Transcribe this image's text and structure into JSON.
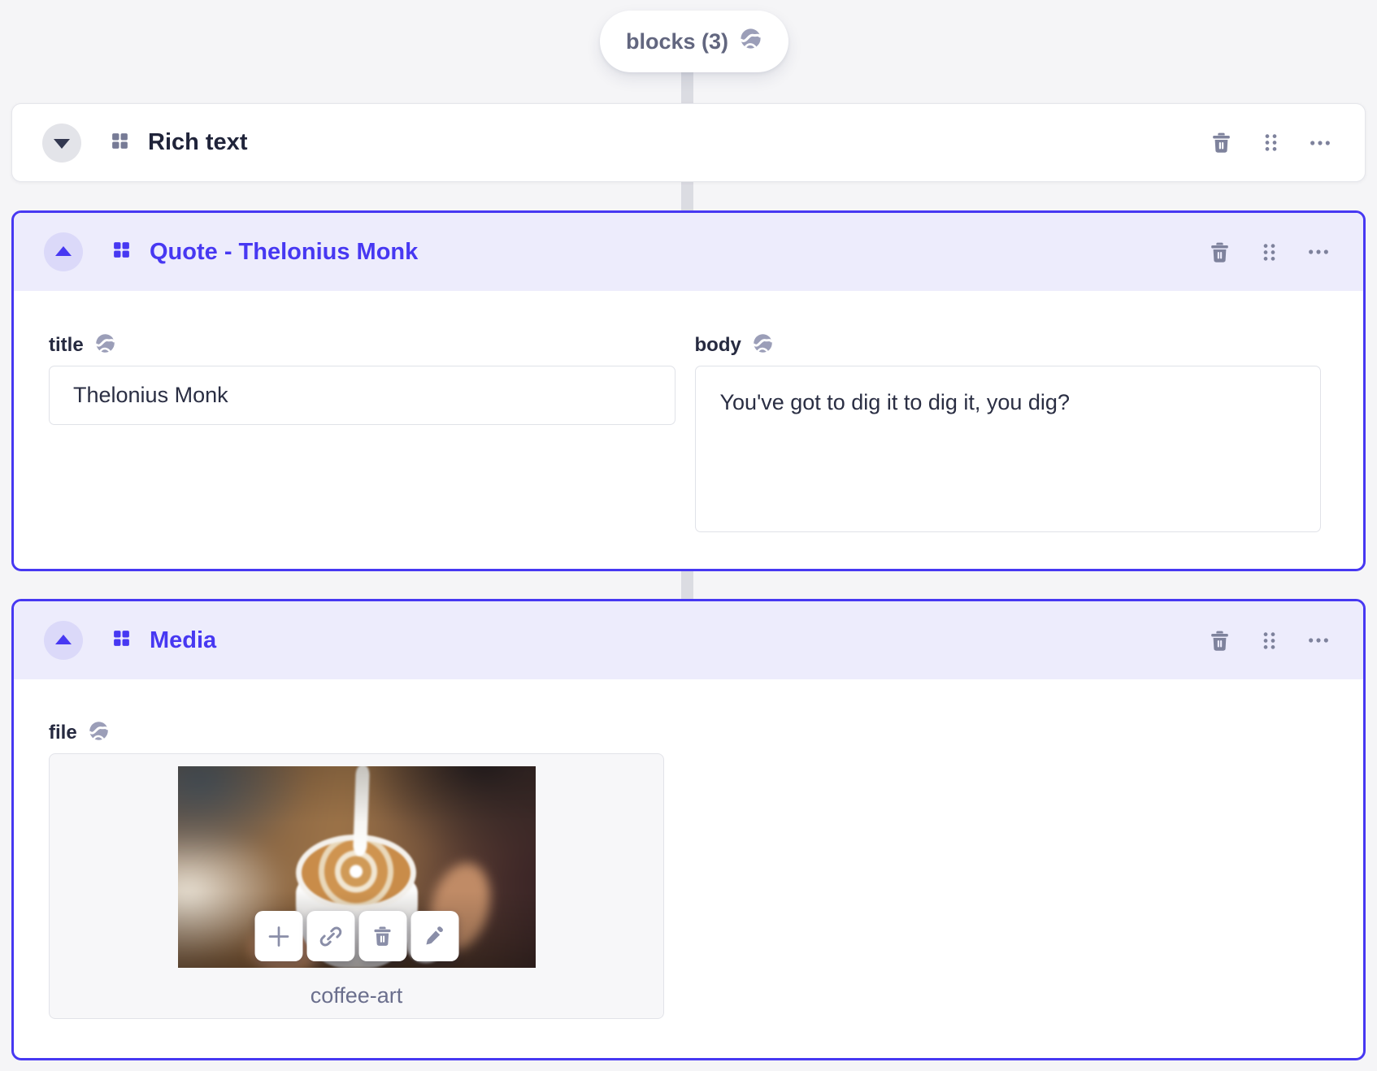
{
  "colors": {
    "accent": "#4738F2",
    "accent_header_bg": "#EDECFC",
    "accent_toggle_bg": "#DBD9F9",
    "muted_icon": "#7E829C",
    "dark_text": "#20243A",
    "muted_text": "#6B6F8D",
    "page_bg": "#F5F5F7",
    "connector": "#DBDCE2"
  },
  "icons": {
    "pill_globe": "globe-icon",
    "block": "blocks-grid-icon",
    "collapse": "chevron-up-icon",
    "expand": "chevron-down-icon",
    "remove": "trash-icon",
    "drag": "drag-handle-icon",
    "menu": "ellipsis-icon",
    "upload": "plus-icon",
    "link": "link-icon",
    "delete_asset": "trash-icon",
    "edit": "pencil-icon"
  },
  "array_field": {
    "pill_label": "blocks (3)"
  },
  "blocks": [
    {
      "title": "Rich text",
      "state": "collapsed"
    },
    {
      "title": "Quote - Thelonius Monk",
      "state": "expanded",
      "fields": {
        "title": {
          "label": "title",
          "value": "Thelonius Monk"
        },
        "body": {
          "label": "body",
          "value": "You've got to dig it to dig it, you dig?"
        }
      }
    },
    {
      "title": "Media",
      "state": "expanded",
      "fields": {
        "file": {
          "label": "file",
          "file_name": "coffee-art"
        }
      }
    }
  ]
}
